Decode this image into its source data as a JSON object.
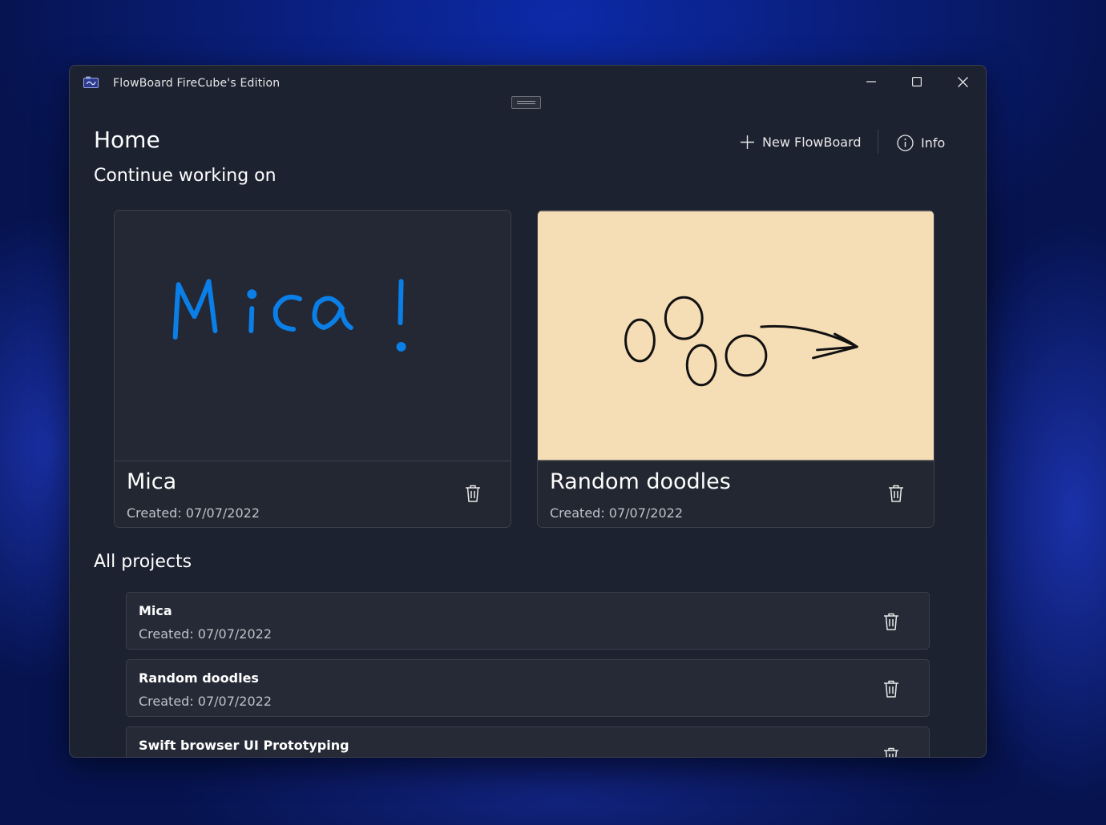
{
  "window": {
    "title": "FlowBoard FireCube's Edition"
  },
  "header": {
    "title": "Home",
    "new_label": "New FlowBoard",
    "info_label": "Info"
  },
  "continue": {
    "title": "Continue working on",
    "cards": [
      {
        "name": "Mica",
        "created": "Created: 07/07/2022",
        "canvas_color": "#232834",
        "ink_color": "#0b7fe8"
      },
      {
        "name": "Random doodles",
        "created": "Created: 07/07/2022",
        "canvas_color": "#f5ddb5",
        "ink_color": "#111111"
      }
    ]
  },
  "projects": {
    "title": "All projects",
    "items": [
      {
        "name": "Mica",
        "created": "Created: 07/07/2022"
      },
      {
        "name": "Random doodles",
        "created": "Created: 07/07/2022"
      },
      {
        "name": "Swift browser UI Prototyping",
        "created": ""
      }
    ]
  }
}
